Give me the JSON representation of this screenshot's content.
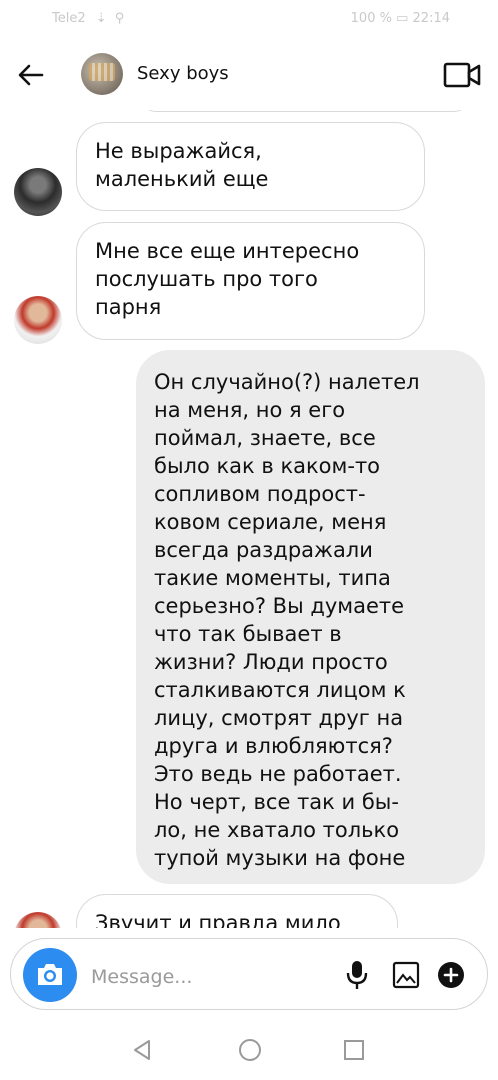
{
  "status_bar": {
    "carrier": "Tele2",
    "battery": "100 %",
    "time": "22:14"
  },
  "header": {
    "title": "Sexy boys",
    "icons": {
      "back": "arrow-left-icon",
      "video": "video-camera-icon"
    }
  },
  "messages": [
    {
      "direction": "incoming",
      "text": "Не выражайся,\nмаленький еще"
    },
    {
      "direction": "incoming",
      "text": "Мне все еще интересно\nпослушать про того\nпарня"
    },
    {
      "direction": "outgoing",
      "text": "Он случайно(?) налетел\nна меня, но я его\nпоймал, знаете, все\nбыло как в каком-то\nсопливом  подрост-\nковом сериале, меня\nвсегда раздражали\nтакие моменты, типа\nсерьезно? Вы думаете\nчто так бывает в\nжизни? Люди просто\nсталкиваются лицом к\nлицу, смотрят друг на\nдруга и влюбляются?\nЭто ведь не работает.\nНо черт, все так и бы-\nло, не хватало только\nтупой музыки на фоне"
    },
    {
      "direction": "incoming",
      "text": "Звучит и правда мило"
    }
  ],
  "composer": {
    "placeholder": "Message...",
    "icons": {
      "camera": "camera-icon",
      "mic": "microphone-icon",
      "gallery": "image-icon",
      "add": "plus-circle-icon"
    }
  },
  "colors": {
    "accent": "#2d8cf0",
    "incoming_border": "#d9d9d9",
    "outgoing_bg": "#ececec"
  }
}
